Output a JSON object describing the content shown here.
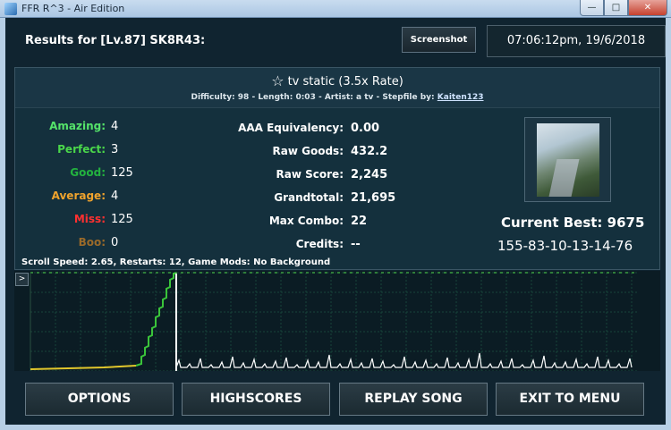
{
  "window": {
    "title": "FFR R^3 - Air Edition",
    "min_icon": "minimize-icon",
    "max_icon": "maximize-icon",
    "close_icon": "close-icon"
  },
  "header": {
    "results_title": "Results for [Lv.87] SK8R43:",
    "screenshot_label": "Screenshot",
    "timestamp": "07:06:12pm, 19/6/2018"
  },
  "song": {
    "star_icon": "star-outline-icon",
    "title": "tv static (3.5x Rate)",
    "meta_prefix": "Difficulty: 98 - Length: 0:03 - Artist: a tv - Stepfile by:",
    "stepfile_author": "Kaiten123"
  },
  "judgements": [
    {
      "label": "Amazing:",
      "value": "4",
      "color": "#55e36a"
    },
    {
      "label": "Perfect:",
      "value": "3",
      "color": "#4ad74a"
    },
    {
      "label": "Good:",
      "value": "125",
      "color": "#23b23f"
    },
    {
      "label": "Average:",
      "value": "4",
      "color": "#f0a32d"
    },
    {
      "label": "Miss:",
      "value": "125",
      "color": "#ff3030"
    },
    {
      "label": "Boo:",
      "value": "0",
      "color": "#9a6a2a"
    }
  ],
  "stats": [
    {
      "label": "AAA Equivalency:",
      "value": "0.00"
    },
    {
      "label": "Raw Goods:",
      "value": "432.2"
    },
    {
      "label": "Raw Score:",
      "value": "2,245"
    },
    {
      "label": "Grandtotal:",
      "value": "21,695"
    },
    {
      "label": "Max Combo:",
      "value": "22"
    },
    {
      "label": "Credits:",
      "value": "--"
    }
  ],
  "current_best": "Current Best: 9675",
  "replay_code": "155-83-10-13-14-76",
  "mods_line": "Scroll Speed: 2.65, Restarts: 12, Game Mods: No Background",
  "graph": {
    "expand_label": ">"
  },
  "buttons": {
    "options": "OPTIONS",
    "highscores": "HIGHSCORES",
    "replay": "REPLAY SONG",
    "exit": "EXIT TO MENU"
  }
}
